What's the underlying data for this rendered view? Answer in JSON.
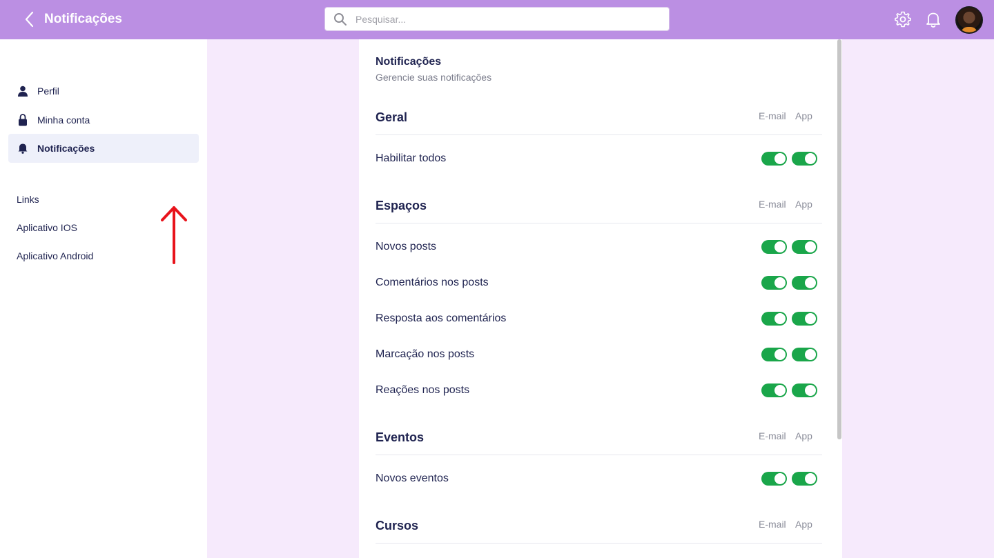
{
  "topbar": {
    "title": "Notificações",
    "search_placeholder": "Pesquisar..."
  },
  "sidebar": {
    "items": [
      {
        "label": "Perfil",
        "icon": "user-icon"
      },
      {
        "label": "Minha conta",
        "icon": "lock-icon"
      },
      {
        "label": "Notificações",
        "icon": "bell-icon",
        "active": true
      }
    ],
    "links": [
      "Links",
      "Aplicativo IOS",
      "Aplicativo Android"
    ]
  },
  "main": {
    "title": "Notificações",
    "subtitle": "Gerencie suas notificações",
    "col_email": "E-mail",
    "col_app": "App",
    "sections": [
      {
        "title": "Geral",
        "rows": [
          {
            "label": "Habilitar todos",
            "email": true,
            "app": true
          }
        ]
      },
      {
        "title": "Espaços",
        "rows": [
          {
            "label": "Novos posts",
            "email": true,
            "app": true
          },
          {
            "label": "Comentários nos posts",
            "email": true,
            "app": true
          },
          {
            "label": "Resposta aos comentários",
            "email": true,
            "app": true
          },
          {
            "label": "Marcação nos posts",
            "email": true,
            "app": true
          },
          {
            "label": "Reações nos posts",
            "email": true,
            "app": true
          }
        ]
      },
      {
        "title": "Eventos",
        "rows": [
          {
            "label": "Novos eventos",
            "email": true,
            "app": true
          }
        ]
      },
      {
        "title": "Cursos",
        "rows": []
      }
    ]
  },
  "colors": {
    "topbar": "#bb8fe3",
    "background": "#f6eafc",
    "toggle_on": "#1aa64a",
    "text": "#1f2350",
    "annotation_arrow": "#e8131b"
  }
}
